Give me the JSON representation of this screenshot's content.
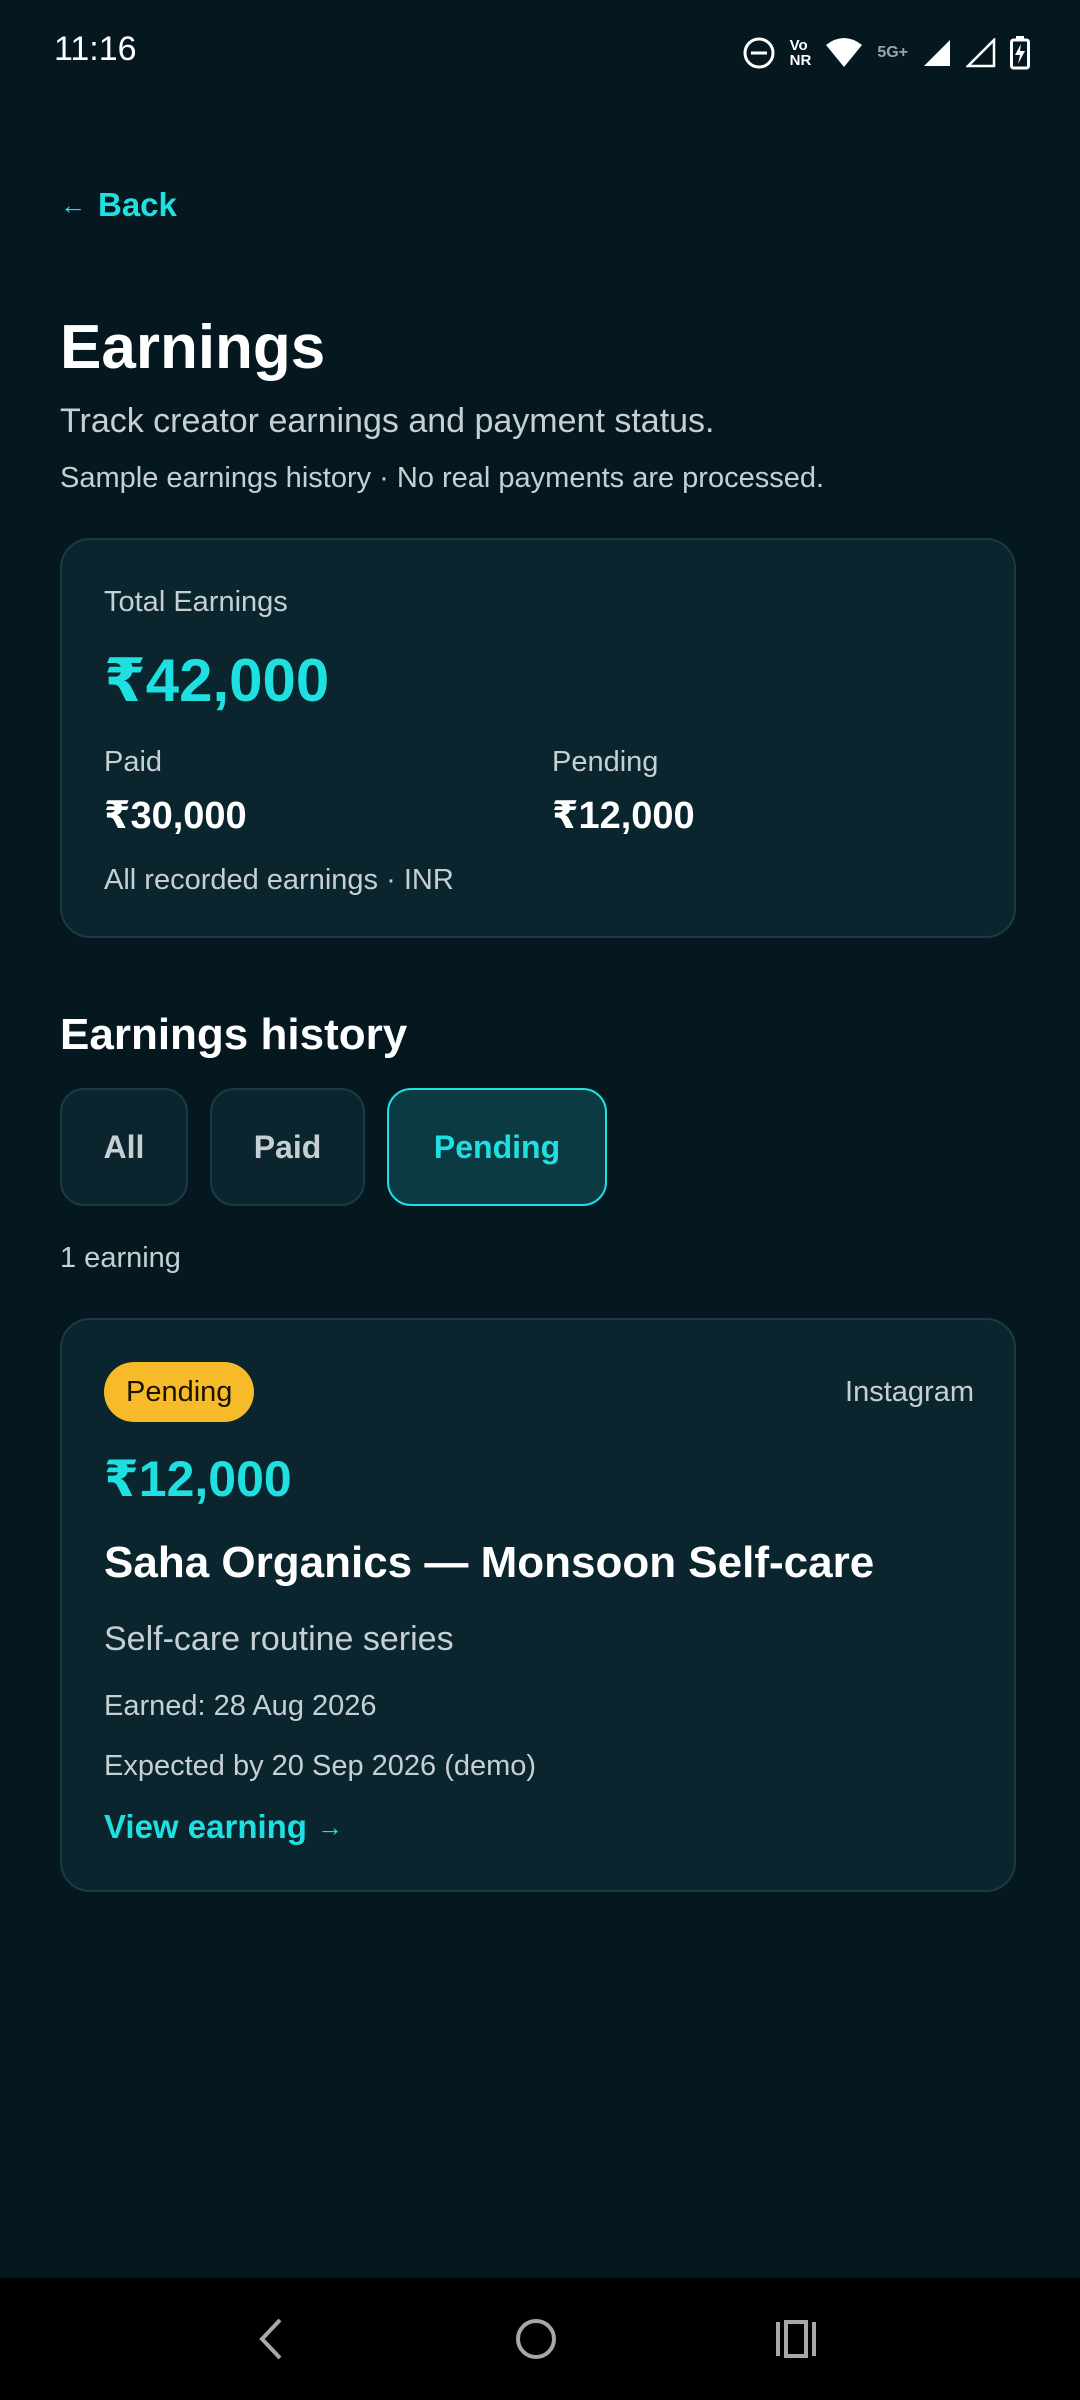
{
  "status_bar": {
    "time": "11:16",
    "icons": [
      "do-not-disturb-icon",
      "volte-icon",
      "wifi-icon",
      "signal-icon",
      "signal-icon",
      "battery-charging-icon"
    ],
    "volte_top": "Vo",
    "volte_bottom": "NR",
    "network_label": "5G+"
  },
  "header": {
    "back_label": "Back",
    "back_icon": "arrow-left-icon",
    "title": "Earnings",
    "subtitle": "Track creator earnings and payment status.",
    "note": "Sample earnings history · No real payments are processed."
  },
  "summary": {
    "total_label": "Total Earnings",
    "total_value": "₹42,000",
    "paid_label": "Paid",
    "paid_value": "₹30,000",
    "pending_label": "Pending",
    "pending_value": "₹12,000",
    "footer": "All recorded earnings · INR"
  },
  "history": {
    "title": "Earnings history",
    "filters": [
      {
        "label": "All",
        "active": false
      },
      {
        "label": "Paid",
        "active": false
      },
      {
        "label": "Pending",
        "active": true
      }
    ],
    "count_text": "1 earning",
    "items": [
      {
        "status": "Pending",
        "platform": "Instagram",
        "amount": "₹12,000",
        "title": "Saha Organics — Monsoon Self-care",
        "description": "Self-care routine series",
        "earned": "Earned: 28 Aug 2026",
        "expected": "Expected by 20 Sep 2026 (demo)",
        "link_label": "View earning"
      }
    ]
  },
  "colors": {
    "background": "#051820",
    "card": "#0a252e",
    "accent": "#1fe0e0",
    "badge_pending": "#f7bb2a",
    "muted_text": "#c6d0d3"
  },
  "nav_bar": {
    "icons": [
      "back-nav-icon",
      "home-nav-icon",
      "recents-nav-icon"
    ]
  }
}
